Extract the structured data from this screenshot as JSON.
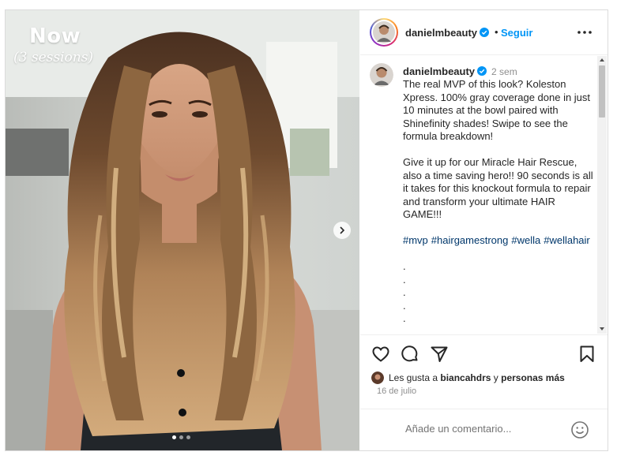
{
  "media": {
    "overlay_title": "Now",
    "overlay_subtitle": "(3 sessions)",
    "carousel_total": 3,
    "carousel_active": 1,
    "next_icon": "chevron-right-icon"
  },
  "header": {
    "username": "danielmbeauty",
    "verified_icon": "verified-badge-icon",
    "separator": "•",
    "follow_label": "Seguir",
    "more_icon": "more-options-icon"
  },
  "caption": {
    "username": "danielmbeauty",
    "time": "2 sem",
    "paragraph1": "The real MVP of this look? Koleston Xpress. 100% gray coverage done in just 10 minutes at the bowl paired with Shinefinity shades! Swipe to see the formula breakdown!",
    "paragraph2": "Give it up for our Miracle Hair Rescue, also a time saving hero!! 90 seconds is all it takes for this knockout formula to repair and transform your ultimate HAIR GAME!!!",
    "hashtags": [
      "#mvp",
      "#hairgamestrong",
      "#wella",
      "#wellahair"
    ],
    "dots": [
      ".",
      ".",
      ".",
      ".",
      "."
    ]
  },
  "actions": {
    "like_icon": "heart-icon",
    "comment_icon": "comment-icon",
    "share_icon": "share-icon",
    "save_icon": "bookmark-icon"
  },
  "likes": {
    "prefix": "Les gusta a",
    "user": "biancahdrs",
    "middle": "y",
    "suffix": "personas más"
  },
  "date": "16 de julio",
  "comment_box": {
    "placeholder": "Añade un comentario...",
    "emoji_icon": "emoji-icon"
  },
  "colors": {
    "accent": "#0095f6",
    "hashtag": "#00376b",
    "muted": "#8e8e8e"
  }
}
